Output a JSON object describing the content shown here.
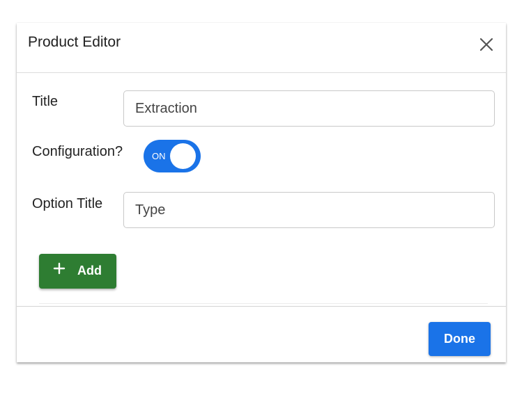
{
  "dialog": {
    "title": "Product Editor",
    "close_icon": "close-icon"
  },
  "form": {
    "title_label": "Title",
    "title_value": "Extraction",
    "configuration_label": "Configuration?",
    "configuration_toggle": {
      "state_text": "ON",
      "checked": true,
      "color": "#1a73e8"
    },
    "option_title_label": "Option Title",
    "option_title_value": "Type"
  },
  "actions": {
    "add_label": "Add",
    "add_icon": "plus-icon",
    "add_color": "#2e7d32",
    "done_label": "Done",
    "done_color": "#1a73e8"
  }
}
